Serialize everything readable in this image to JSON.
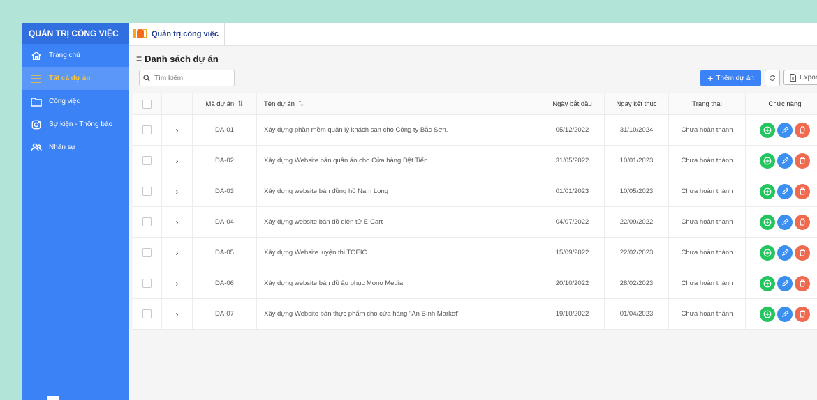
{
  "sidebar": {
    "brand": "QUẢN TRỊ CÔNG VIỆC",
    "items": [
      {
        "label": "Trang chủ",
        "icon": "home-icon"
      },
      {
        "label": "Tất cả dự án",
        "icon": "menu-icon",
        "active": true
      },
      {
        "label": "Công việc",
        "icon": "folder-icon"
      },
      {
        "label": "Sự kiện - Thông báo",
        "icon": "instagram-icon"
      },
      {
        "label": "Nhân sự",
        "icon": "users-icon"
      }
    ]
  },
  "topbar": {
    "tab_label": "Quản trị công việc"
  },
  "page": {
    "title": "Danh sách dự án"
  },
  "search": {
    "placeholder": "Tìm kiếm"
  },
  "toolbar": {
    "add_label": "Thêm dự án",
    "export_label": "Export"
  },
  "table": {
    "headers": {
      "code": "Mã dự án",
      "name": "Tên dự án",
      "start": "Ngày bắt đầu",
      "end": "Ngày kết thúc",
      "status": "Trạng thái",
      "actions": "Chức năng"
    },
    "rows": [
      {
        "code": "DA-01",
        "name": "Xây dựng phần mềm quản lý khách sạn cho Công ty Bắc Sơn.",
        "start": "05/12/2022",
        "end": "31/10/2024",
        "status": "Chưa hoàn thành"
      },
      {
        "code": "DA-02",
        "name": "Xây dựng Website bán quần áo cho Cửa hàng Dệt Tiến",
        "start": "31/05/2022",
        "end": "10/01/2023",
        "status": "Chưa hoàn thành"
      },
      {
        "code": "DA-03",
        "name": "Xây dựng website bán đồng hồ Nam Long",
        "start": "01/01/2023",
        "end": "10/05/2023",
        "status": "Chưa hoàn thành"
      },
      {
        "code": "DA-04",
        "name": "Xây dựng website bán đồ điện tử E-Cart",
        "start": "04/07/2022",
        "end": "22/09/2022",
        "status": "Chưa hoàn thành"
      },
      {
        "code": "DA-05",
        "name": "Xây dựng Website luyện thi TOEIC",
        "start": "15/09/2022",
        "end": "22/02/2023",
        "status": "Chưa hoàn thành"
      },
      {
        "code": "DA-06",
        "name": "Xây dựng website bán đồ âu phục Mono Media",
        "start": "20/10/2022",
        "end": "28/02/2023",
        "status": "Chưa hoàn thành"
      },
      {
        "code": "DA-07",
        "name": "Xây dựng Website bán thực phẩm cho cửa hàng \"An Bình Market\"",
        "start": "19/10/2022",
        "end": "01/04/2023",
        "status": "Chưa hoàn thành"
      }
    ]
  },
  "colors": {
    "sidebar": "#3b82f6",
    "active_text": "#f8c33a",
    "primary": "#3b82f6",
    "add": "#22c55e",
    "edit": "#3b8ff0",
    "delete": "#ef6a4f"
  }
}
